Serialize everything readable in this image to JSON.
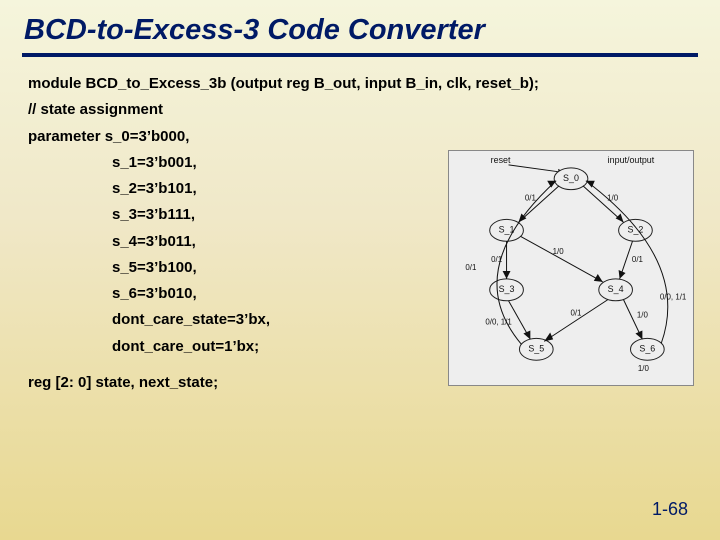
{
  "title": "BCD-to-Excess-3 Code Converter",
  "code": {
    "module_decl": "module  BCD_to_Excess_3b (output reg B_out, input B_in, clk, reset_b);",
    "comment": "// state assignment",
    "param_head": "parameter s_0=3’b000,",
    "params": [
      "s_1=3’b001,",
      "s_2=3’b101,",
      "s_3=3’b111,",
      "s_4=3’b011,",
      "s_5=3’b100,",
      "s_6=3’b010,",
      "dont_care_state=3’bx,",
      "dont_care_out=1’bx;"
    ],
    "reg_decl": "reg [2: 0] state, next_state;"
  },
  "diagram": {
    "top_left": "reset",
    "top_right": "input/output",
    "nodes": [
      "S_0",
      "S_1",
      "S_2",
      "S_3",
      "S_4",
      "S_5",
      "S_6"
    ],
    "edge_labels": {
      "s0_s1": "0/1",
      "s0_s2": "1/0",
      "s1_s3": "0/1",
      "s12_s4": "1/0",
      "s2_s4": "0/1",
      "s3_s5_a": "0/0, 1/1",
      "s4_s5": "0/1",
      "s4_s6": "1/0",
      "s5_s0": "0/1",
      "s6_s0_a": "0/0, 1/1",
      "s6_s0_b": "1/0"
    }
  },
  "page_number": "1-68"
}
